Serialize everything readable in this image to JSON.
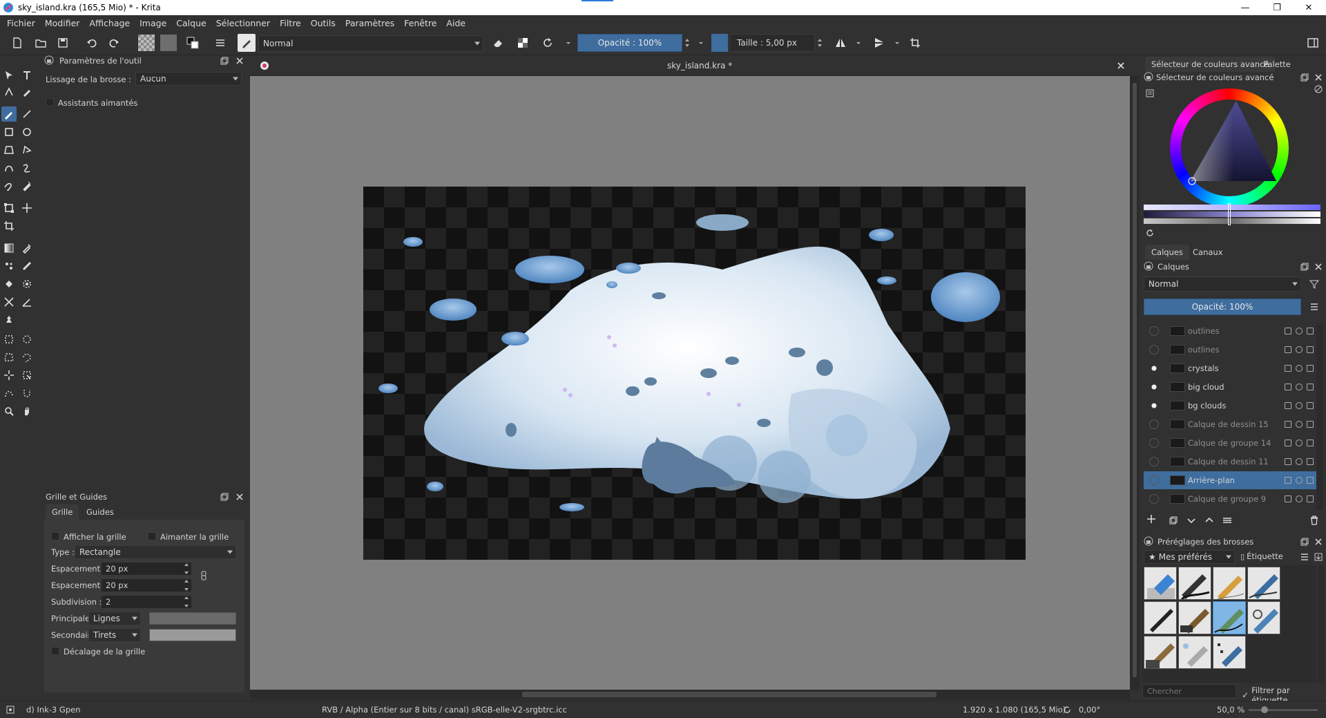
{
  "window": {
    "title": "sky_island.kra (165,5 Mio)  * - Krita",
    "minimize": "—",
    "maximize": "❐",
    "close": "✕"
  },
  "menu": [
    "Fichier",
    "Modifier",
    "Affichage",
    "Image",
    "Calque",
    "Sélectionner",
    "Filtre",
    "Outils",
    "Paramètres",
    "Fenêtre",
    "Aide"
  ],
  "toolbar": {
    "blend_mode": "Normal",
    "opacity": "Opacité : 100%",
    "size": "Taille : 5,00 px"
  },
  "tool_options": {
    "title": "Paramètres de l'outil",
    "smoothing_label": "Lissage de la brosse :",
    "smoothing_value": "Aucun",
    "magnetic_label": "Assistants aimantés"
  },
  "grid": {
    "title": "Grille et Guides",
    "tabs": [
      "Grille",
      "Guides"
    ],
    "show_grid": "Afficher la grille",
    "snap_grid": "Aimanter la grille",
    "type_label": "Type :",
    "type_value": "Rectangle",
    "spacing_x_label": "Espacement X :",
    "spacing_x": "20 px",
    "spacing_y_label": "Espacement Y :",
    "spacing_y": "20 px",
    "subdivision_label": "Subdivision :",
    "subdivision": "2",
    "main_label": "Principale :",
    "main_value": "Lignes",
    "secondary_label": "Secondaire :",
    "secondary_value": "Tirets",
    "offset_label": "Décalage de la grille"
  },
  "document": {
    "tab_title": "sky_island.kra *"
  },
  "color_selector": {
    "tabs": [
      "Sélecteur de couleurs avancé",
      "Palette"
    ],
    "title": "Sélecteur de couleurs avancé"
  },
  "layers": {
    "tabs": [
      "Calques",
      "Canaux"
    ],
    "title": "Calques",
    "blend_mode": "Normal",
    "opacity": "Opacité:  100%",
    "items": [
      {
        "name": "outlines",
        "visible": false
      },
      {
        "name": "outlines",
        "visible": false
      },
      {
        "name": "crystals",
        "visible": true
      },
      {
        "name": "big cloud",
        "visible": true
      },
      {
        "name": "bg clouds",
        "visible": true
      },
      {
        "name": "Calque de dessin 15",
        "visible": false
      },
      {
        "name": "Calque de groupe 14",
        "visible": false
      },
      {
        "name": "Calque de dessin 11",
        "visible": false
      },
      {
        "name": "Arrière-plan",
        "visible": false,
        "selected": true
      },
      {
        "name": "Calque de groupe 9",
        "visible": false
      }
    ]
  },
  "brushes": {
    "title": "Préréglages des brosses",
    "favorites": "Mes préférés",
    "tag_label": "Étiquette",
    "search_placeholder": "Chercher",
    "filter_label": "Filtrer par étiquette"
  },
  "status": {
    "brush": "d) Ink-3 Gpen",
    "color_space": "RVB / Alpha (Entier sur 8 bits / canal)  sRGB-elle-V2-srgbtrc.icc",
    "dimensions": "1.920 x 1.080 (165,5 Mio)",
    "rotation": "0,00°",
    "zoom": "50,0 %"
  },
  "colors": {
    "accent": "#3f6d9e",
    "panel": "#313131",
    "canvas_bg": "#808080"
  }
}
